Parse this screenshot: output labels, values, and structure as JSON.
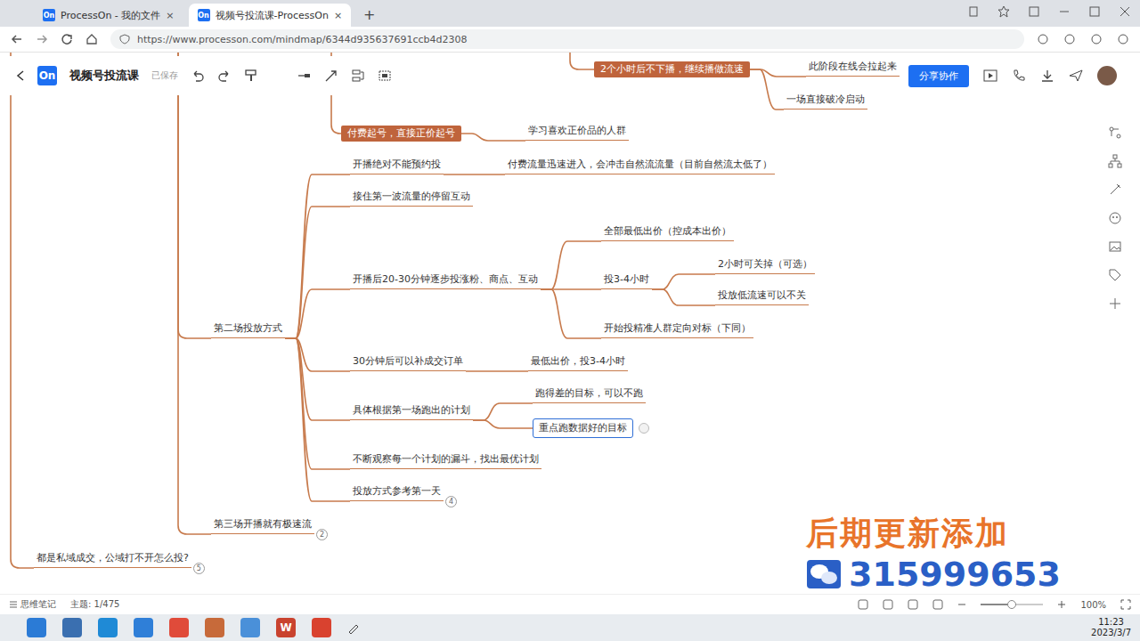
{
  "browser": {
    "tabs": [
      {
        "favicon": "On",
        "label": "ProcessOn - 我的文件",
        "close": "×",
        "selected": false
      },
      {
        "favicon": "On",
        "label": "视频号投流课-ProcessOn",
        "close": "×",
        "selected": true
      }
    ],
    "new_tab": "+",
    "url": "https://www.processon.com/mindmap/6344d935637691ccb4d2308"
  },
  "app": {
    "logo": "On",
    "title": "视频号投流课",
    "save_status": "已保存",
    "share_button": "分享协作"
  },
  "mindmap": {
    "nodes": [
      {
        "text": "2个小时后不下播，继续播做流速",
        "kind": "filled"
      },
      {
        "text": "此阶段在线会拉起来",
        "kind": "underline"
      },
      {
        "text": "一场直接破冷启动",
        "kind": "underline"
      },
      {
        "text": "付费起号，直接正价起号",
        "kind": "filled"
      },
      {
        "text": "学习喜欢正价品的人群",
        "kind": "underline"
      },
      {
        "text": "第二场投放方式",
        "kind": "underline"
      },
      {
        "text": "开播绝对不能预约投",
        "kind": "underline"
      },
      {
        "text": "付费流量迅速进入，会冲击自然流流量（目前自然流太低了）",
        "kind": "underline"
      },
      {
        "text": "接住第一波流量的停留互动",
        "kind": "underline"
      },
      {
        "text": "开播后20-30分钟逐步投涨粉、商点、互动",
        "kind": "underline"
      },
      {
        "text": "全部最低出价（控成本出价）",
        "kind": "underline"
      },
      {
        "text": "投3-4小时",
        "kind": "underline"
      },
      {
        "text": "2小时可关掉（可选）",
        "kind": "underline"
      },
      {
        "text": "投放低流速可以不关",
        "kind": "underline"
      },
      {
        "text": "开始投精准人群定向对标（下同）",
        "kind": "underline"
      },
      {
        "text": "30分钟后可以补成交订单",
        "kind": "underline"
      },
      {
        "text": "最低出价，投3-4小时",
        "kind": "underline"
      },
      {
        "text": "具体根据第一场跑出的计划",
        "kind": "underline"
      },
      {
        "text": "跑得差的目标，可以不跑",
        "kind": "underline"
      },
      {
        "text": "重点跑数据好的目标",
        "kind": "selected"
      },
      {
        "text": "不断观察每一个计划的漏斗，找出最优计划",
        "kind": "underline"
      },
      {
        "text": "投放方式参考第一天",
        "kind": "underline",
        "badge": "4"
      },
      {
        "text": "第三场开播就有极速流",
        "kind": "underline",
        "badge": "2"
      },
      {
        "text": "都是私域成交，公域打不开怎么投?",
        "kind": "underline",
        "badge": "5"
      }
    ]
  },
  "watermark": {
    "line1": "后期更新添加",
    "line2": "315999653"
  },
  "status_bar": {
    "notes": "思维笔记",
    "topic": "主题: 1/475",
    "zoom": "100%",
    "zoom_level": 0.5
  },
  "taskbar": {
    "word_icon": "W",
    "time": "11:23",
    "date": "2023/3/7"
  }
}
